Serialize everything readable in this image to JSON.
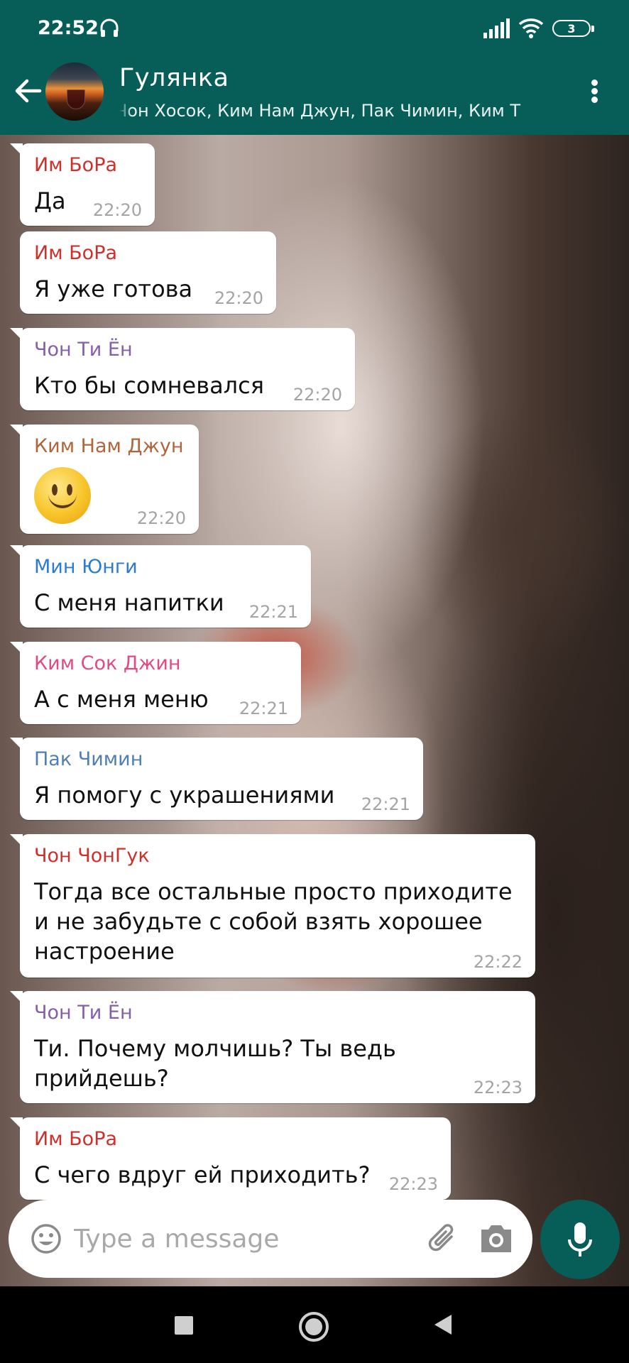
{
  "status_bar": {
    "time": "22:52",
    "battery_level": "3",
    "icons": [
      "headphones-icon",
      "signal-icon",
      "wifi-icon",
      "battery-icon"
    ]
  },
  "header": {
    "title": "Гулянка",
    "members": "и, Чон Хосок, Ким Нам Джун, Пак Чимин, Ким Т",
    "icons": [
      "back-arrow-icon",
      "group-avatar",
      "more-vertical-icon"
    ]
  },
  "messages": [
    {
      "sender": "Им БоРа",
      "text": "Да",
      "time": "22:20",
      "sender_color": "#d0302a"
    },
    {
      "sender": "Им БоРа",
      "text": "Я уже готова",
      "time": "22:20",
      "sender_color": "#d0302a"
    },
    {
      "sender": "Чон Ти Ён",
      "text": "Кто бы сомневался",
      "time": "22:20",
      "sender_color": "#8460a8"
    },
    {
      "sender": "Ким Нам Джун",
      "text": "🙂",
      "time": "22:20",
      "sender_color": "#b2643a"
    },
    {
      "sender": "Мин Юнги",
      "text": "С меня напитки",
      "time": "22:21",
      "sender_color": "#2b7bd3"
    },
    {
      "sender": "Ким Сок Джин",
      "text": "А с меня меню",
      "time": "22:21",
      "sender_color": "#e34a83"
    },
    {
      "sender": "Пак Чимин",
      "text": "Я помогу с украшениями",
      "time": "22:21",
      "sender_color": "#4f7fb5"
    },
    {
      "sender": "Чон ЧонГук",
      "text": "Тогда все остальные просто приходите и не забудьте с собой взять хорошее настроение",
      "time": "22:22",
      "sender_color": "#d0302a"
    },
    {
      "sender": "Чон Ти Ён",
      "text": "Ти. Почему молчишь? Ты ведь прийдешь?",
      "time": "22:23",
      "sender_color": "#8460a8"
    },
    {
      "sender": "Им БоРа",
      "text": "С чего вдруг ей приходить?",
      "time": "22:23",
      "sender_color": "#d0302a"
    }
  ],
  "composer": {
    "placeholder": "Type a message",
    "icons": [
      "emoji-icon",
      "attach-icon",
      "camera-icon",
      "mic-icon"
    ]
  },
  "nav_bar": {
    "icons": [
      "recents-icon",
      "home-icon",
      "back-icon"
    ]
  },
  "colors": {
    "primary": "#075e58",
    "bubble": "#ffffff",
    "timestamp": "#a4a4a4"
  }
}
